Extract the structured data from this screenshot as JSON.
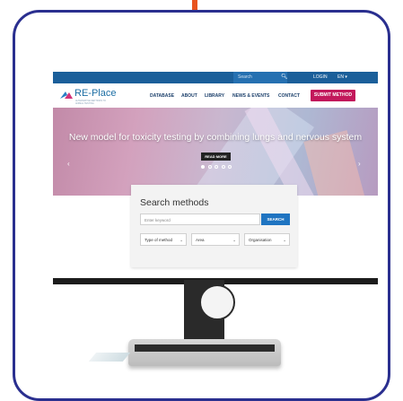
{
  "topbar": {
    "search_placeholder": "Search",
    "search_icon": "search-icon",
    "login_label": "LOGIN",
    "language": "EN ▾"
  },
  "navbar": {
    "logo_text": "RE-Place",
    "logo_subtitle": "ALTERNATIVE METHODS TO ANIMAL TESTING",
    "items": [
      "DATABASE",
      "ABOUT",
      "LIBRARY",
      "NEWS & EVENTS",
      "CONTACT"
    ],
    "submit_label": "SUBMIT METHOD"
  },
  "hero": {
    "headline": "New model for toxicity testing by combining lungs and nervous system",
    "read_more_label": "READ MORE",
    "slide_count": 5,
    "active_slide": 1,
    "prev_arrow": "‹",
    "next_arrow": "›"
  },
  "search_panel": {
    "title": "Search methods",
    "keyword_placeholder": "Enter keyword",
    "search_button": "SEARCH",
    "dropdowns": [
      {
        "label": "Type of method"
      },
      {
        "label": "Area"
      },
      {
        "label": "Organisation"
      }
    ]
  },
  "colors": {
    "frame_border": "#2a2f8f",
    "accent": "#e8531e",
    "topbar": "#1b5f9a",
    "submit_button": "#c2185b",
    "search_button": "#1f74c1"
  }
}
